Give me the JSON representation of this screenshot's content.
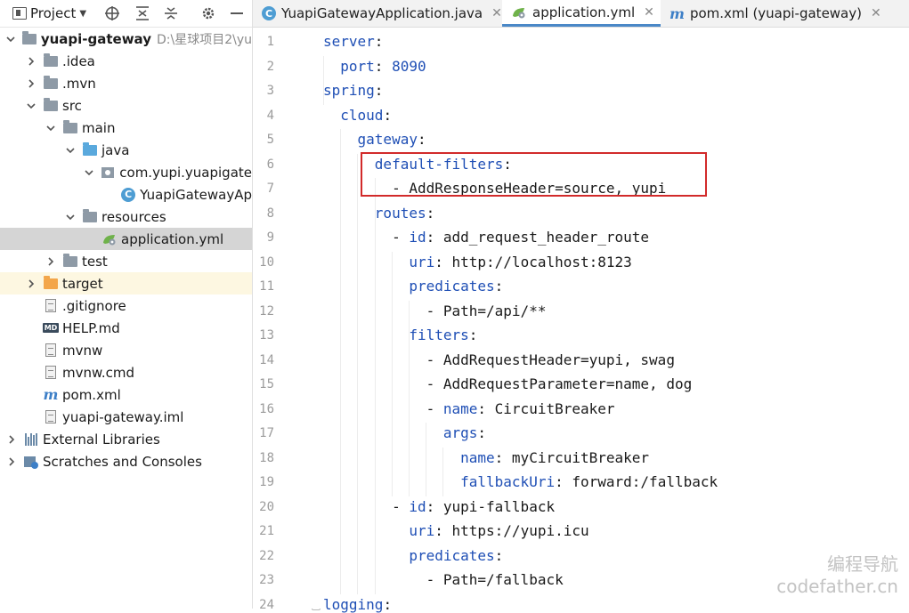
{
  "project_panel": {
    "toolbar": {
      "title": "Project",
      "icons": [
        "chevron-down-icon",
        "locate-icon",
        "expand-all-icon",
        "collapse-all-icon",
        "gear-icon",
        "minimize-icon"
      ]
    },
    "tree": [
      {
        "label": "yuapi-gateway",
        "path": "D:\\星球项目2\\yu",
        "depth": 0,
        "icon": "module-folder",
        "expanded": true,
        "bold": true
      },
      {
        "label": ".idea",
        "depth": 1,
        "icon": "folder",
        "expanded": false
      },
      {
        "label": ".mvn",
        "depth": 1,
        "icon": "folder",
        "expanded": false
      },
      {
        "label": "src",
        "depth": 1,
        "icon": "folder",
        "expanded": true
      },
      {
        "label": "main",
        "depth": 2,
        "icon": "folder",
        "expanded": true
      },
      {
        "label": "java",
        "depth": 3,
        "icon": "folder-blue",
        "expanded": true
      },
      {
        "label": "com.yupi.yuapigate",
        "depth": 4,
        "icon": "package",
        "expanded": true
      },
      {
        "label": "YuapiGatewayAp",
        "depth": 5,
        "icon": "java-class"
      },
      {
        "label": "resources",
        "depth": 3,
        "icon": "folder-resources",
        "expanded": true
      },
      {
        "label": "application.yml",
        "depth": 4,
        "icon": "spring-yml",
        "selected": true
      },
      {
        "label": "test",
        "depth": 2,
        "icon": "folder",
        "expanded": false
      },
      {
        "label": "target",
        "depth": 1,
        "icon": "folder-orange",
        "expanded": false,
        "excluded": true
      },
      {
        "label": ".gitignore",
        "depth": 1,
        "icon": "file"
      },
      {
        "label": "HELP.md",
        "depth": 1,
        "icon": "markdown"
      },
      {
        "label": "mvnw",
        "depth": 1,
        "icon": "file"
      },
      {
        "label": "mvnw.cmd",
        "depth": 1,
        "icon": "file"
      },
      {
        "label": "pom.xml",
        "depth": 1,
        "icon": "maven"
      },
      {
        "label": "yuapi-gateway.iml",
        "depth": 1,
        "icon": "file"
      },
      {
        "label": "External Libraries",
        "depth": 0,
        "icon": "library",
        "expanded": false
      },
      {
        "label": "Scratches and Consoles",
        "depth": 0,
        "icon": "scratches",
        "expanded": false
      }
    ]
  },
  "editor": {
    "tabs": [
      {
        "label": "YuapiGatewayApplication.java",
        "active": false
      },
      {
        "label": "application.yml",
        "active": true
      },
      {
        "label": "pom.xml (yuapi-gateway)",
        "active": false
      }
    ],
    "highlighted_line": 19,
    "lines": [
      {
        "n": "1",
        "text": "server:"
      },
      {
        "n": "2",
        "text": "  port: 8090"
      },
      {
        "n": "3",
        "text": "spring:"
      },
      {
        "n": "4",
        "text": "  cloud:"
      },
      {
        "n": "5",
        "text": "    gateway:"
      },
      {
        "n": "6",
        "text": "      default-filters:"
      },
      {
        "n": "7",
        "text": "        - AddResponseHeader=source, yupi"
      },
      {
        "n": "8",
        "text": "      routes:"
      },
      {
        "n": "9",
        "text": "        - id: add_request_header_route"
      },
      {
        "n": "10",
        "text": "          uri: http://localhost:8123"
      },
      {
        "n": "11",
        "text": "          predicates:"
      },
      {
        "n": "12",
        "text": "            - Path=/api/**"
      },
      {
        "n": "13",
        "text": "          filters:"
      },
      {
        "n": "14",
        "text": "            - AddRequestHeader=yupi, swag"
      },
      {
        "n": "15",
        "text": "            - AddRequestParameter=name, dog"
      },
      {
        "n": "16",
        "text": "            - name: CircuitBreaker"
      },
      {
        "n": "17",
        "text": "              args:"
      },
      {
        "n": "18",
        "text": "                name: myCircuitBreaker"
      },
      {
        "n": "19",
        "text": "                fallbackUri: forward:/fallback"
      },
      {
        "n": "20",
        "text": "        - id: yupi-fallback"
      },
      {
        "n": "21",
        "text": "          uri: https://yupi.icu"
      },
      {
        "n": "22",
        "text": "          predicates:"
      },
      {
        "n": "23",
        "text": "            - Path=/fallback"
      },
      {
        "n": "24",
        "text": "logging:"
      }
    ]
  },
  "watermark": {
    "line1": "编程导航",
    "line2": "codefather.cn"
  },
  "colors": {
    "key": "#1f4fb5",
    "annotation_box": "#d22a2a",
    "selection": "#d5d5d5",
    "tab_underline": "#4a88c7"
  }
}
